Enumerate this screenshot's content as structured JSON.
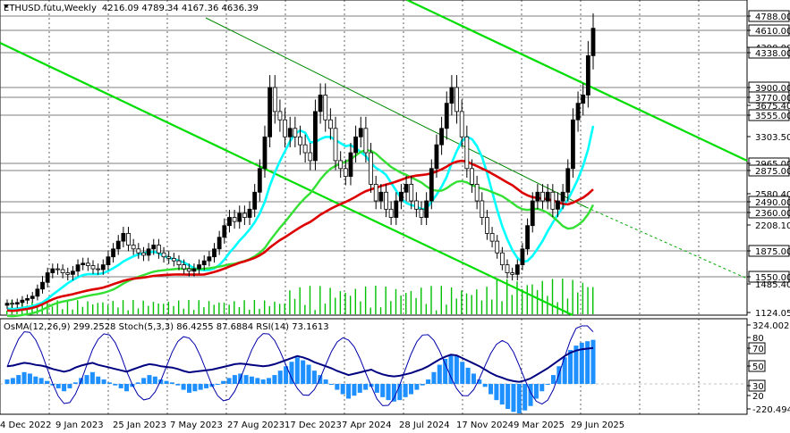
{
  "header": {
    "symbol": "ETHUSD.futu,Weekly",
    "ohlc": "4216.09 4789.34 4167.36 4636.39"
  },
  "chart_data": [
    {
      "type": "candlestick",
      "title": "ETHUSD.futu,Weekly",
      "y_ticks": [
        {
          "v": 4788.0,
          "label": "4788.00",
          "boxed": true
        },
        {
          "v": 4610.0,
          "label": "4610.00",
          "boxed": true
        },
        {
          "v": 4390.0,
          "label": "4390.00",
          "boxed": false
        },
        {
          "v": 4338.0,
          "label": "4338.00",
          "boxed": true
        },
        {
          "v": 3900.0,
          "label": "3900.00",
          "boxed": true
        },
        {
          "v": 3770.0,
          "label": "3770.00",
          "boxed": true
        },
        {
          "v": 3675.4,
          "label": "3675.40",
          "boxed": false
        },
        {
          "v": 3555.0,
          "label": "3555.00",
          "boxed": true
        },
        {
          "v": 3303.5,
          "label": "3303.50",
          "boxed": false
        },
        {
          "v": 2965.0,
          "label": "2965.00",
          "boxed": true
        },
        {
          "v": 2875.0,
          "label": "2875.00",
          "boxed": true
        },
        {
          "v": 2580.4,
          "label": "2580.40",
          "boxed": false
        },
        {
          "v": 2490.0,
          "label": "2490.00",
          "boxed": true
        },
        {
          "v": 2360.0,
          "label": "2360.00",
          "boxed": true
        },
        {
          "v": 2208.1,
          "label": "2208.10",
          "boxed": false
        },
        {
          "v": 1875.0,
          "label": "1875.00",
          "boxed": true
        },
        {
          "v": 1550.0,
          "label": "1550.00",
          "boxed": true
        },
        {
          "v": 1485.4,
          "label": "1485.40",
          "boxed": false
        },
        {
          "v": 1124.05,
          "label": "1124.05",
          "boxed": false
        }
      ],
      "x_labels": [
        "4 Dec 2022",
        "9 Jan 2023",
        "25 Jan 2023",
        "7 May 2023",
        "27 Aug 2023",
        "17 Dec 2023",
        "7 Apr 2024",
        "28 Jul 2024",
        "17 Nov 2024",
        "9 Mar 2025",
        "29 Jun 2025"
      ],
      "levels": [
        4788,
        4610,
        4338,
        3900,
        3770,
        3555,
        2965,
        2875,
        2490,
        2360,
        1875,
        1550
      ],
      "close": [
        1240,
        1230,
        1250,
        1280,
        1300,
        1330,
        1420,
        1500,
        1600,
        1650,
        1640,
        1600,
        1580,
        1620,
        1700,
        1720,
        1690,
        1650,
        1640,
        1700,
        1800,
        1900,
        2000,
        2100,
        1950,
        1900,
        1850,
        1820,
        1900,
        1950,
        1850,
        1800,
        1780,
        1750,
        1700,
        1650,
        1620,
        1650,
        1700,
        1750,
        1800,
        1900,
        2050,
        2200,
        2300,
        2250,
        2350,
        2300,
        2400,
        2600,
        2900,
        3300,
        3900,
        3600,
        3500,
        3300,
        3400,
        3300,
        3200,
        3100,
        3000,
        3600,
        3800,
        3500,
        3400,
        3000,
        2900,
        2800,
        3100,
        3300,
        3400,
        3100,
        2700,
        2500,
        2600,
        2400,
        2300,
        2500,
        2600,
        2700,
        2500,
        2400,
        2300,
        2500,
        2900,
        3200,
        3400,
        3700,
        3900,
        3600,
        3300,
        2900,
        2700,
        2500,
        2300,
        2100,
        2000,
        1850,
        1700,
        1600,
        1580,
        1700,
        1900,
        2200,
        2500,
        2600,
        2500,
        2600,
        2400,
        2500,
        2600,
        2900,
        3500,
        3700,
        3800,
        4300,
        4636
      ],
      "moving_averages": [
        {
          "name": "MA fast",
          "color": "#00ffff"
        },
        {
          "name": "MA mid",
          "color": "#00ff00"
        },
        {
          "name": "MA slow",
          "color": "#ff0000"
        }
      ]
    },
    {
      "type": "oscillator",
      "title": "OsMA(12,26,9) 299.2528  Stoch(5,3,3) 86.4255 87.6884  RSI(14) 73.1613",
      "y_ticks": [
        {
          "v": 324.0027,
          "label": "324.0027",
          "boxed": false
        },
        {
          "v": 80,
          "label": "80",
          "boxed": false
        },
        {
          "v": 70,
          "label": "70",
          "boxed": true
        },
        {
          "v": 50,
          "label": "50",
          "boxed": true
        },
        {
          "v": 30,
          "label": "30",
          "boxed": true
        },
        {
          "v": 20,
          "label": "20",
          "boxed": false
        },
        {
          "v": -220.4941,
          "label": "-220.4941",
          "boxed": false
        }
      ],
      "osma_values": [
        30,
        40,
        60,
        80,
        70,
        50,
        40,
        20,
        -10,
        -30,
        -50,
        -30,
        10,
        40,
        60,
        80,
        50,
        30,
        10,
        -10,
        -30,
        -50,
        -20,
        10,
        40,
        60,
        50,
        30,
        20,
        10,
        -10,
        -40,
        -60,
        -50,
        -40,
        -30,
        -20,
        0,
        20,
        40,
        60,
        70,
        60,
        50,
        40,
        30,
        40,
        60,
        90,
        120,
        150,
        180,
        160,
        130,
        90,
        60,
        30,
        0,
        -40,
        -70,
        -100,
        -80,
        -60,
        -40,
        -20,
        -60,
        -90,
        -110,
        -120,
        -110,
        -90,
        -70,
        -40,
        -10,
        30,
        80,
        130,
        170,
        200,
        190,
        150,
        110,
        70,
        30,
        -20,
        -70,
        -110,
        -140,
        -170,
        -190,
        -200,
        -180,
        -150,
        -100,
        -50,
        0,
        60,
        120,
        180,
        230,
        260,
        280,
        290,
        299
      ]
    }
  ]
}
